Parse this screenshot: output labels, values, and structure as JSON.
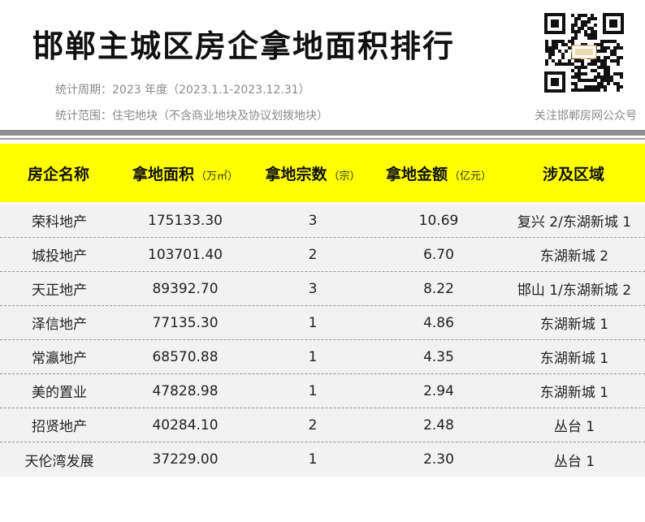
{
  "header": {
    "title": "邯郸主城区房企拿地面积排行",
    "period": "统计周期：2023 年度（2023.1.1-2023.12.31）",
    "scope": "统计范围：住宅地块（不含商业地块及协议划拨地块）",
    "follow": "关注邯郸房网公众号",
    "qr_icon": "qr-code-icon"
  },
  "table": {
    "columns": [
      {
        "label": "房企名称",
        "unit": ""
      },
      {
        "label": "拿地面积",
        "unit": "（万㎡）"
      },
      {
        "label": "拿地宗数",
        "unit": "（宗）"
      },
      {
        "label": "拿地金额",
        "unit": "（亿元）"
      },
      {
        "label": "涉及区域",
        "unit": ""
      }
    ],
    "rows": [
      [
        "荣科地产",
        "175133.30",
        "3",
        "10.69",
        "复兴 2/东湖新城 1"
      ],
      [
        "城投地产",
        "103701.40",
        "2",
        "6.70",
        "东湖新城 2"
      ],
      [
        "天正地产",
        "89392.70",
        "3",
        "8.22",
        "邯山 1/东湖新城 2"
      ],
      [
        "泽信地产",
        "77135.30",
        "1",
        "4.86",
        "东湖新城 1"
      ],
      [
        "常瀛地产",
        "68570.88",
        "1",
        "4.35",
        "东湖新城 1"
      ],
      [
        "美的置业",
        "47828.98",
        "1",
        "2.94",
        "东湖新城 1"
      ],
      [
        "招贤地产",
        "40284.10",
        "2",
        "2.48",
        "丛台 1"
      ],
      [
        "天伦湾发展",
        "37229.00",
        "1",
        "2.30",
        "丛台 1"
      ]
    ]
  },
  "colors": {
    "header_bg": "#ffff00",
    "row_bg": "#f2f2f2",
    "rule": "#8e8e8e"
  }
}
